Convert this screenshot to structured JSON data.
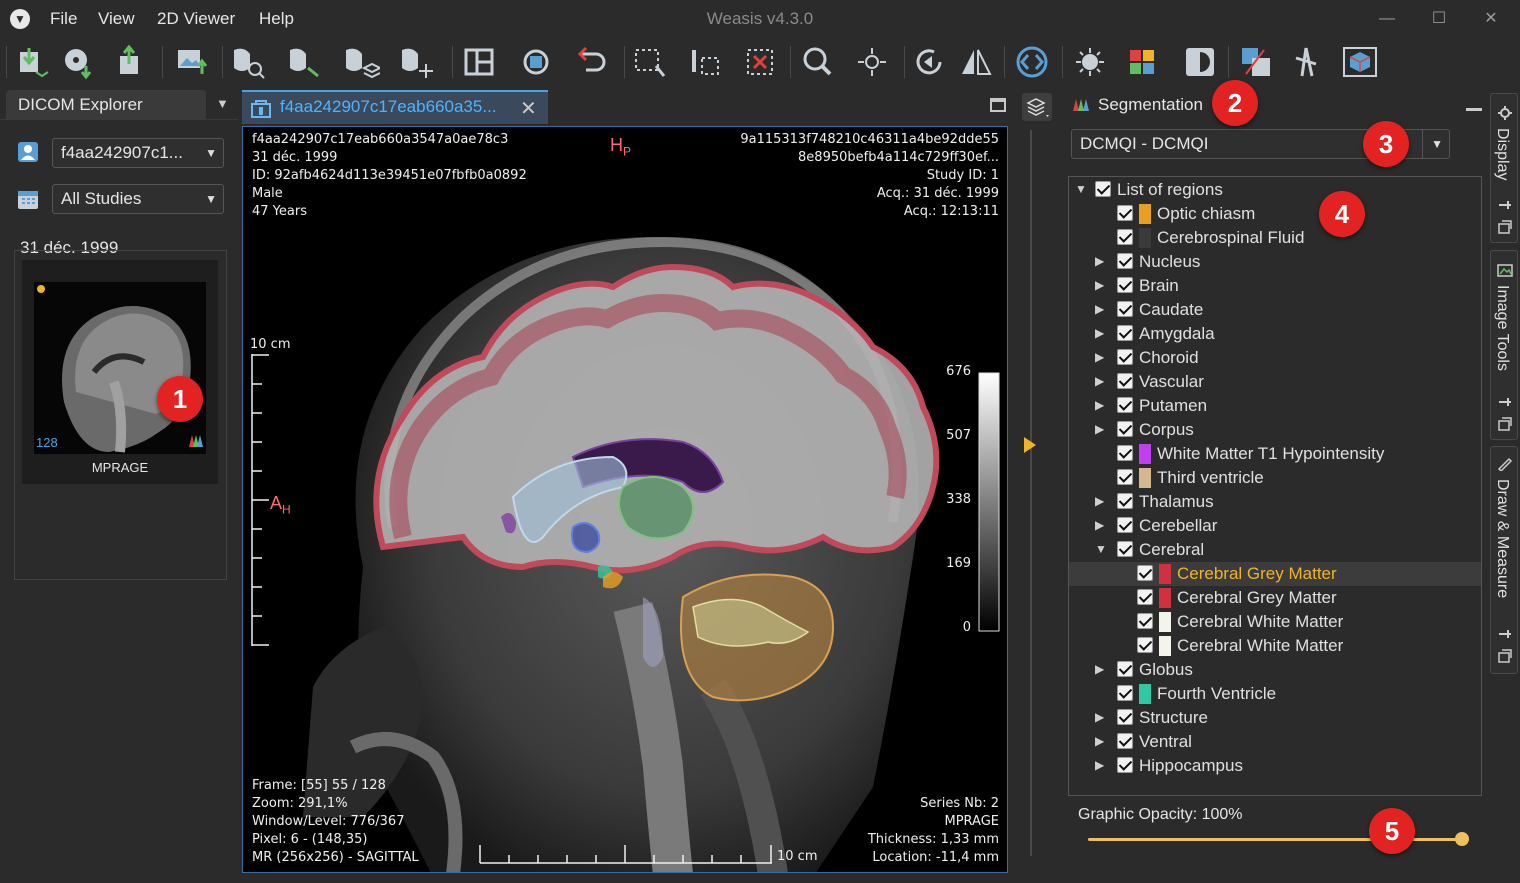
{
  "app": {
    "title": "Weasis v4.3.0",
    "menu": [
      "File",
      "View",
      "2D Viewer",
      "Help"
    ]
  },
  "toolbar": {
    "buttons": [
      "import-dicom",
      "import-cd",
      "export-dicom",
      "export-image",
      "zoom-tool",
      "pan-tool",
      "window-level-tool",
      "crosshair-tool",
      "layout",
      "sync",
      "reset",
      "select-region",
      "measure",
      "delete",
      "magnifier",
      "zoom-fit",
      "rotate",
      "flip",
      "cine",
      "brightness",
      "lut",
      "invert",
      "mpr",
      "cut",
      "3d"
    ]
  },
  "explorer": {
    "tab_label": "DICOM Explorer",
    "patient_combo": "f4aa242907c1...",
    "studies_combo": "All Studies",
    "study_date": "31 déc. 1999",
    "thumbnail": {
      "count": "128",
      "label": "MPRAGE"
    }
  },
  "viewer": {
    "tab_title": "f4aa242907c17eab660a35...",
    "overlay": {
      "top_left": [
        "f4aa242907c17eab660a3547a0ae78c3",
        "31 déc. 1999",
        "ID: 92afb4624d113e39451e07fbfb0a0892",
        "Male",
        "47 Years"
      ],
      "top_right": [
        "9a115313f748210c46311a4be92dde55",
        "8e8950befb4a114c729ff30ef...",
        "Study ID: 1",
        "Acq.: 31 déc. 1999",
        "Acq.: 12:13:11"
      ],
      "bottom_left": [
        "Frame: [55] 55 / 128",
        "Zoom: 291,1%",
        "Window/Level: 776/367",
        "Pixel: 6 - (148,35)",
        "MR (256x256) - SAGITTAL"
      ],
      "bottom_right": [
        "Series Nb: 2",
        "MPRAGE",
        "Thickness: 1,33 mm",
        "Location: -11,4 mm"
      ],
      "orientation_top": "H",
      "orientation_top_sub": "P",
      "orientation_left": "A",
      "orientation_left_sub": "H",
      "scale_vertical": "10 cm",
      "scale_horizontal": "10 cm",
      "lut_ticks": [
        "676",
        "507",
        "338",
        "169",
        "0"
      ]
    }
  },
  "segmentation": {
    "title": "Segmentation",
    "combo": "DCMQI - DCMQI",
    "tree": [
      {
        "label": "List of regions",
        "level": 0,
        "expand": "open"
      },
      {
        "label": "Optic chiasm",
        "level": 1,
        "swatch": "#e8a020"
      },
      {
        "label": "Cerebrospinal Fluid",
        "level": 1,
        "swatch": "#3a3a3a"
      },
      {
        "label": "Nucleus",
        "level": 1,
        "expand": "closed"
      },
      {
        "label": "Brain",
        "level": 1,
        "expand": "closed"
      },
      {
        "label": "Caudate",
        "level": 1,
        "expand": "closed"
      },
      {
        "label": "Amygdala",
        "level": 1,
        "expand": "closed"
      },
      {
        "label": "Choroid",
        "level": 1,
        "expand": "closed"
      },
      {
        "label": "Vascular",
        "level": 1,
        "expand": "closed"
      },
      {
        "label": "Putamen",
        "level": 1,
        "expand": "closed"
      },
      {
        "label": "Corpus",
        "level": 1,
        "expand": "closed"
      },
      {
        "label": "White Matter T1 Hypointensity",
        "level": 1,
        "swatch": "#c040f0"
      },
      {
        "label": "Third ventricle",
        "level": 1,
        "swatch": "#d4b890"
      },
      {
        "label": "Thalamus",
        "level": 1,
        "expand": "closed"
      },
      {
        "label": "Cerebellar",
        "level": 1,
        "expand": "closed"
      },
      {
        "label": "Cerebral",
        "level": 1,
        "expand": "open"
      },
      {
        "label": "Cerebral Grey Matter",
        "level": 2,
        "swatch": "#d03040",
        "selected": true
      },
      {
        "label": "Cerebral Grey Matter",
        "level": 2,
        "swatch": "#d03040"
      },
      {
        "label": "Cerebral White Matter",
        "level": 2,
        "swatch": "#f4f4ec"
      },
      {
        "label": "Cerebral White Matter",
        "level": 2,
        "swatch": "#f4f4ec"
      },
      {
        "label": "Globus",
        "level": 1,
        "expand": "closed"
      },
      {
        "label": "Fourth Ventricle",
        "level": 1,
        "swatch": "#30c8a0"
      },
      {
        "label": "Structure",
        "level": 1,
        "expand": "closed"
      },
      {
        "label": "Ventral",
        "level": 1,
        "expand": "closed"
      },
      {
        "label": "Hippocampus",
        "level": 1,
        "expand": "closed"
      }
    ],
    "opacity_label": "Graphic Opacity: 100%",
    "opacity_value": 1.0
  },
  "side_tabs": [
    "Display",
    "Image Tools",
    "Draw & Measure"
  ],
  "callouts": [
    "1",
    "2",
    "3",
    "4",
    "5"
  ],
  "colors": {
    "accent": "#4aa3e8",
    "selection": "#f0b429",
    "callout": "#e32222"
  }
}
